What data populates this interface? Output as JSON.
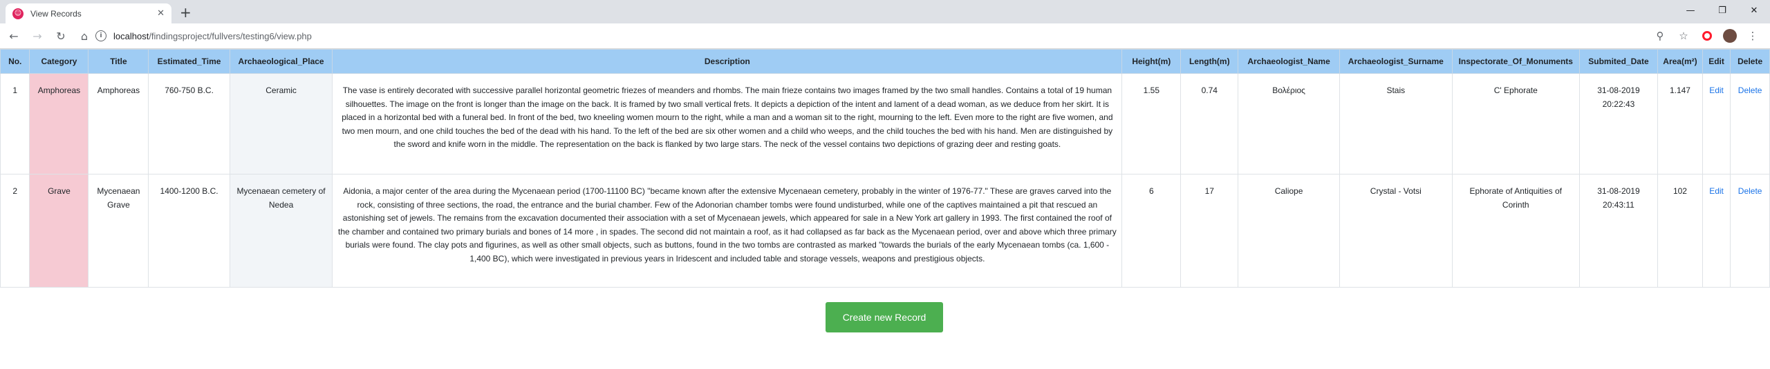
{
  "browser": {
    "tab_title": "View Records",
    "tab_favicon": "☺",
    "url_host": "localhost",
    "url_path": "/findingsproject/fullvers/testing6/view.php"
  },
  "table": {
    "headers": [
      "No.",
      "Category",
      "Title",
      "Estimated_Time",
      "Archaeological_Place",
      "Description",
      "Height(m)",
      "Length(m)",
      "Archaeologist_Name",
      "Archaeologist_Surname",
      "Inspectorate_Of_Monuments",
      "Submited_Date",
      "Area(m²)",
      "Edit",
      "Delete"
    ],
    "rows": [
      {
        "no": "1",
        "category": "Amphoreas",
        "title": "Amphoreas",
        "estimated_time": "760-750 B.C.",
        "place": "Ceramic",
        "description": "The vase is entirely decorated with successive parallel horizontal geometric friezes of meanders and rhombs. The main frieze contains two images framed by the two small handles. Contains a total of 19 human silhouettes. The image on the front is longer than the image on the back. It is framed by two small vertical frets. It depicts a depiction of the intent and lament of a dead woman, as we deduce from her skirt. It is placed in a horizontal bed with a funeral bed. In front of the bed, two kneeling women mourn to the right, while a man and a woman sit to the right, mourning to the left. Even more to the right are five women, and two men mourn, and one child touches the bed of the dead with his hand. To the left of the bed are six other women and a child who weeps, and the child touches the bed with his hand. Men are distinguished by the sword and knife worn in the middle. The representation on the back is flanked by two large stars. The neck of the vessel contains two depictions of grazing deer and resting goats.",
        "height": "1.55",
        "length": "0.74",
        "arch_name": "Βολέριος",
        "arch_surname": "Stais",
        "inspectorate": "C' Ephorate",
        "date": "31-08-2019",
        "time": "20:22:43",
        "area": "1.147",
        "edit": "Edit",
        "delete": "Delete"
      },
      {
        "no": "2",
        "category": "Grave",
        "title": "Mycenaean Grave",
        "estimated_time": "1400-1200 B.C.",
        "place": "Mycenaean cemetery of Nedea",
        "description": "Aidonia, a major center of the area during the Mycenaean period (1700-11100 BC) \"became known after the extensive Mycenaean cemetery, probably in the winter of 1976-77.\" These are graves carved into the rock, consisting of three sections, the road, the entrance and the burial chamber. Few of the Adonorian chamber tombs were found undisturbed, while one of the captives maintained a pit that rescued an astonishing set of jewels. The remains from the excavation documented their association with a set of Mycenaean jewels, which appeared for sale in a New York art gallery in 1993. The first contained the roof of the chamber and contained two primary burials and bones of 14 more , in spades. The second did not maintain a roof, as it had collapsed as far back as the Mycenaean period, over and above which three primary burials were found. The clay pots and figurines, as well as other small objects, such as buttons, found in the two tombs are contrasted as marked \"towards the burials of the early Mycenaean tombs (ca. 1,600 - 1,400 BC), which were investigated in previous years in Iridescent and included table and storage vessels, weapons and prestigious objects.",
        "height": "6",
        "length": "17",
        "arch_name": "Caliope",
        "arch_surname": "Crystal - Votsi",
        "inspectorate": "Ephorate of Antiquities of Corinth",
        "date": "31-08-2019",
        "time": "20:43:11",
        "area": "102",
        "edit": "Edit",
        "delete": "Delete"
      }
    ]
  },
  "create_button": "Create new Record",
  "colors": {
    "header_bg": "#9fccf4",
    "category_bg": "#f6cad3",
    "button_bg": "#4caf50",
    "link": "#1a73e8"
  },
  "icons": {
    "back": "back-arrow-icon",
    "forward": "forward-arrow-icon",
    "reload": "reload-icon",
    "home": "home-icon",
    "zoom": "zoom-icon",
    "bookmark": "star-icon",
    "menu": "menu-dots-icon"
  }
}
